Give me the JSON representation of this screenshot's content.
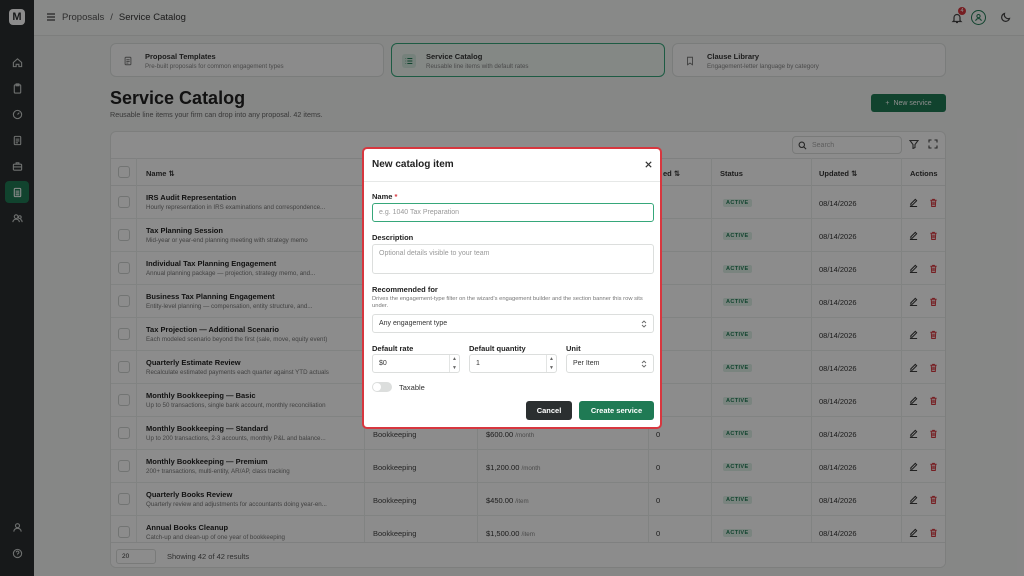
{
  "app": {
    "logo_letter": "M"
  },
  "topbar": {
    "breadcrumb": [
      "Proposals",
      "Service Catalog"
    ],
    "separator": "/",
    "notification_count": "4"
  },
  "cards": [
    {
      "title": "Proposal Templates",
      "subtitle": "Pre-built proposals for common engagement types",
      "icon": "document-icon"
    },
    {
      "title": "Service Catalog",
      "subtitle": "Reusable line items with default rates",
      "icon": "list-icon"
    },
    {
      "title": "Clause Library",
      "subtitle": "Engagement-letter language by category",
      "icon": "bookmark-icon"
    }
  ],
  "page": {
    "title": "Service Catalog",
    "subtitle": "Reusable line items your firm can drop into any proposal. 42 items.",
    "new_button": "New service"
  },
  "toolbar": {
    "search_placeholder": "Search"
  },
  "table": {
    "headers": {
      "name": "Name ⇅",
      "used": "ed ⇅",
      "status": "Status",
      "updated": "Updated ⇅",
      "actions": "Actions"
    },
    "rows": [
      {
        "name": "IRS Audit Representation",
        "desc": "Hourly representation in IRS examinations and correspondence...",
        "category": "",
        "rate": "",
        "unit": "",
        "used": "",
        "status": "ACTIVE",
        "updated": "08/14/2026"
      },
      {
        "name": "Tax Planning Session",
        "desc": "Mid-year or year-end planning meeting with strategy memo",
        "category": "",
        "rate": "",
        "unit": "",
        "used": "",
        "status": "ACTIVE",
        "updated": "08/14/2026"
      },
      {
        "name": "Individual Tax Planning Engagement",
        "desc": "Annual planning package — projection, strategy memo, and...",
        "category": "",
        "rate": "",
        "unit": "",
        "used": "",
        "status": "ACTIVE",
        "updated": "08/14/2026"
      },
      {
        "name": "Business Tax Planning Engagement",
        "desc": "Entity-level planning — compensation, entity structure, and...",
        "category": "",
        "rate": "",
        "unit": "",
        "used": "",
        "status": "ACTIVE",
        "updated": "08/14/2026"
      },
      {
        "name": "Tax Projection — Additional Scenario",
        "desc": "Each modeled scenario beyond the first (sale, move, equity event)",
        "category": "",
        "rate": "",
        "unit": "",
        "used": "",
        "status": "ACTIVE",
        "updated": "08/14/2026"
      },
      {
        "name": "Quarterly Estimate Review",
        "desc": "Recalculate estimated payments each quarter against YTD actuals",
        "category": "",
        "rate": "",
        "unit": "",
        "used": "",
        "status": "ACTIVE",
        "updated": "08/14/2026"
      },
      {
        "name": "Monthly Bookkeeping — Basic",
        "desc": "Up to 50 transactions, single bank account, monthly reconciliation",
        "category": "",
        "rate": "",
        "unit": "",
        "used": "",
        "status": "ACTIVE",
        "updated": "08/14/2026"
      },
      {
        "name": "Monthly Bookkeeping — Standard",
        "desc": "Up to 200 transactions, 2-3 accounts, monthly P&L and balance...",
        "category": "Bookkeeping",
        "rate": "$600.00",
        "unit": "/month",
        "used": "0",
        "status": "ACTIVE",
        "updated": "08/14/2026"
      },
      {
        "name": "Monthly Bookkeeping — Premium",
        "desc": "200+ transactions, multi-entity, AR/AP, class tracking",
        "category": "Bookkeeping",
        "rate": "$1,200.00",
        "unit": "/month",
        "used": "0",
        "status": "ACTIVE",
        "updated": "08/14/2026"
      },
      {
        "name": "Quarterly Books Review",
        "desc": "Quarterly review and adjustments for accountants doing year-en...",
        "category": "Bookkeeping",
        "rate": "$450.00",
        "unit": "/item",
        "used": "0",
        "status": "ACTIVE",
        "updated": "08/14/2026"
      },
      {
        "name": "Annual Books Cleanup",
        "desc": "Catch-up and clean-up of one year of bookkeeping",
        "category": "Bookkeeping",
        "rate": "$1,500.00",
        "unit": "/item",
        "used": "0",
        "status": "ACTIVE",
        "updated": "08/14/2026"
      }
    ]
  },
  "footer": {
    "page_size": "20",
    "showing": "Showing 42 of 42 results"
  },
  "modal": {
    "title": "New catalog item",
    "name_label": "Name",
    "name_required": "*",
    "name_placeholder": "e.g. 1040 Tax Preparation",
    "description_label": "Description",
    "description_placeholder": "Optional details visible to your team",
    "recommended_label": "Recommended for",
    "recommended_help": "Drives the engagement-type filter on the wizard's engagement builder and the section banner this row sits under.",
    "recommended_value": "Any engagement type",
    "rate_label": "Default rate",
    "rate_value": "$0",
    "quantity_label": "Default quantity",
    "quantity_value": "1",
    "unit_label": "Unit",
    "unit_value": "Per Item",
    "taxable_label": "Taxable",
    "taxable_on": false,
    "cancel_label": "Cancel",
    "create_label": "Create service"
  },
  "colors": {
    "accent": "#1f7a54",
    "danger": "#d7373f",
    "rail": "#2b2f30"
  }
}
